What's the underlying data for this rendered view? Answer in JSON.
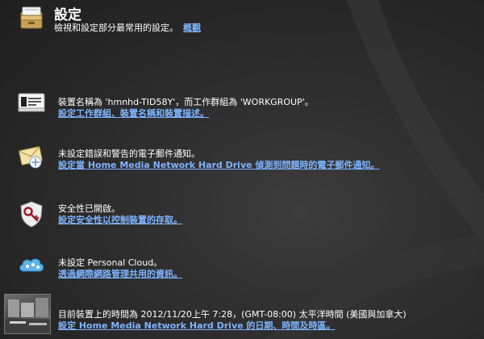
{
  "header": {
    "title": "設定",
    "subtitle": "檢視和設定部分最常用的設定。",
    "overview_link": "概觀",
    "icon": "drawer-icon"
  },
  "items": [
    {
      "icon": "device-icon",
      "desc": "裝置名稱為 'hmnhd-TID58Y'，而工作群組為 'WORKGROUP'。",
      "link": "設定工作群組、裝置名稱和裝置描述。"
    },
    {
      "icon": "email-icon",
      "desc": "未設定錯誤和警告的電子郵件通知。",
      "link": "設定當 Home Media Network Hard Drive 偵測到問題時的電子郵件通知。"
    },
    {
      "icon": "security-shield-icon",
      "desc": "安全性已開啟。",
      "link": "設定安全性以控制裝置的存取。"
    },
    {
      "icon": "cloud-icon",
      "desc": "未設定 Personal Cloud。",
      "link": "透過網際網路管理共用的資訊。"
    },
    {
      "icon": "clock-thumbnail",
      "desc": "目前裝置上的時間為 2012/11/20上午 7:28，(GMT-08:00) 太平洋時間 (美國與加拿大)",
      "link": "設定 Home Media Network Hard Drive 的日期、時間及時區。"
    }
  ],
  "colors": {
    "link": "#7fb3ff",
    "text": "#ffffff",
    "background": "#2b2b2b"
  }
}
